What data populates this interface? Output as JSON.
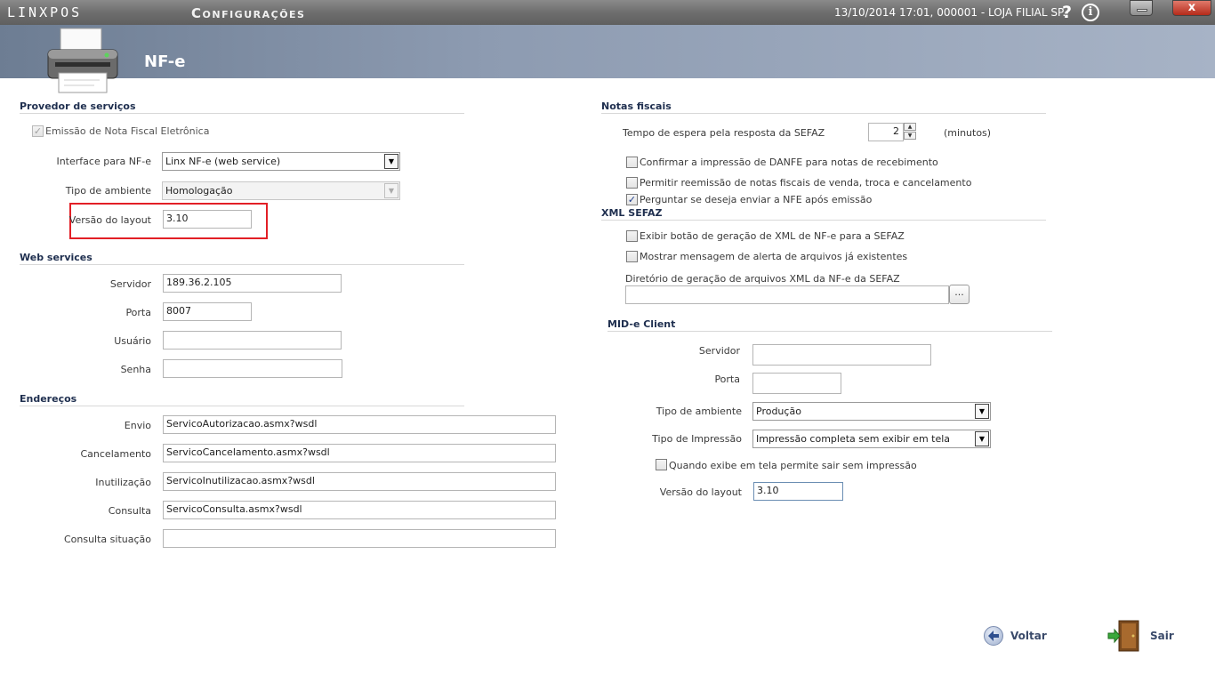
{
  "titlebar": {
    "brand": "LINXPOS",
    "title": "Configurações",
    "session_info": "13/10/2014 17:01, 000001 - LOJA FILIAL SP.",
    "help": "?",
    "info": "i",
    "close": "x"
  },
  "header": {
    "title": "NF-e",
    "icon": "printer-icon"
  },
  "provider": {
    "title": "Provedor de serviços",
    "emission_checkbox": {
      "label": "Emissão de Nota Fiscal Eletrônica",
      "checked": true
    },
    "interface_label": "Interface para NF-e",
    "interface_value": "Linx NF-e (web service)",
    "env_label": "Tipo de ambiente",
    "env_value": "Homologação",
    "layout_label": "Versão do layout",
    "layout_value": "3.10"
  },
  "webservices": {
    "title": "Web services",
    "server_label": "Servidor",
    "server_value": "189.36.2.105",
    "port_label": "Porta",
    "port_value": "8007",
    "user_label": "Usuário",
    "user_value": "",
    "password_label": "Senha",
    "password_value": ""
  },
  "addresses": {
    "title": "Endereços",
    "rows": [
      {
        "label": "Envio",
        "value": "ServicoAutorizacao.asmx?wsdl"
      },
      {
        "label": "Cancelamento",
        "value": "ServicoCancelamento.asmx?wsdl"
      },
      {
        "label": "Inutilização",
        "value": "ServicoInutilizacao.asmx?wsdl"
      },
      {
        "label": "Consulta",
        "value": "ServicoConsulta.asmx?wsdl"
      },
      {
        "label": "Consulta situação",
        "value": ""
      }
    ]
  },
  "invoices": {
    "title": "Notas fiscais",
    "wait_label": "Tempo de espera pela resposta da SEFAZ",
    "wait_value": "2",
    "wait_unit": "(minutos)",
    "checks": [
      {
        "label": "Confirmar a impressão de DANFE para notas de recebimento",
        "checked": false
      },
      {
        "label": "Permitir reemissão de notas fiscais de venda, troca e cancelamento",
        "checked": false
      },
      {
        "label": "Perguntar se deseja enviar a NFE após emissão",
        "checked": true
      }
    ]
  },
  "xml": {
    "title": "XML SEFAZ",
    "checks": [
      {
        "label": "Exibir botão de geração de XML de NF-e para a SEFAZ",
        "checked": false
      },
      {
        "label": "Mostrar mensagem de alerta de arquivos já existentes",
        "checked": false
      }
    ],
    "dir_label": "Diretório de geração de arquivos XML da NF-e da SEFAZ",
    "dir_value": "",
    "browse_label": "..."
  },
  "mide": {
    "title": "MID-e Client",
    "server_label": "Servidor",
    "server_value": "",
    "port_label": "Porta",
    "port_value": "",
    "env_label": "Tipo de ambiente",
    "env_value": "Produção",
    "print_label": "Tipo de Impressão",
    "print_value": "Impressão completa sem exibir em tela",
    "exit_check": {
      "label": "Quando exibe em tela permite sair sem impressão",
      "checked": false
    },
    "layout_label": "Versão do layout",
    "layout_value": "3.10"
  },
  "footer": {
    "back_label": "Voltar",
    "exit_label": "Sair"
  },
  "colors": {
    "header": "#8d9bb1",
    "titlebar": "#6e6e6e",
    "section_title": "#1f2f4f",
    "highlight": "#e21f26"
  }
}
